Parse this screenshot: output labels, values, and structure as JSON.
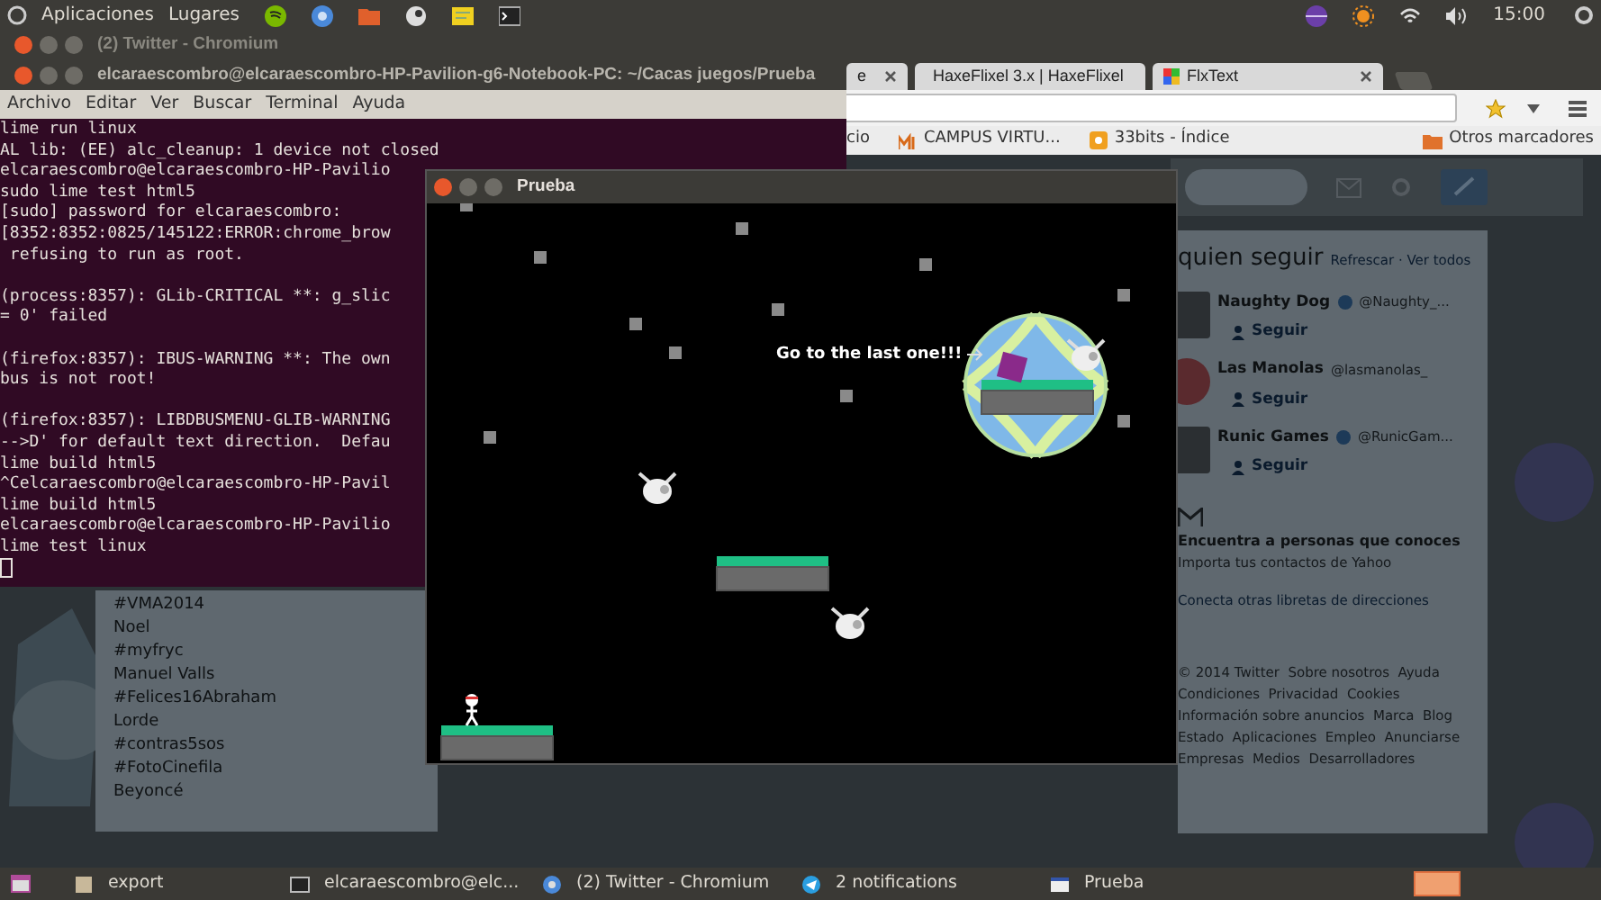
{
  "top_panel": {
    "menus": [
      "Aplicaciones",
      "Lugares"
    ],
    "clock": "15:00"
  },
  "browser": {
    "title": "(2) Twitter - Chromium",
    "tabs": [
      {
        "label": "e",
        "selected": false
      },
      {
        "label": "HaxeFlixel 3.x | HaxeFlixel",
        "selected": false
      },
      {
        "label": "FlxText",
        "selected": false
      }
    ],
    "bookmarks": [
      "cio",
      "CAMPUS VIRTU...",
      "33bits - Índice"
    ],
    "other_bookmarks": "Otros marcadores",
    "trends": [
      "#VMA2014",
      "Noel",
      "#myfryc",
      "Manuel Valls",
      "#Felices16Abraham",
      "Lorde",
      "#contras5sos",
      "#FotoCinefila",
      "Beyoncé"
    ],
    "who_to_follow": {
      "heading": "quien seguir",
      "links": "Refrescar · Ver todos",
      "accounts": [
        {
          "name": "Naughty Dog",
          "handle": "@Naughty_...",
          "button": "Seguir",
          "verified": true
        },
        {
          "name": "Las Manolas",
          "handle": "@lasmanolas_",
          "button": "Seguir",
          "verified": false
        },
        {
          "name": "Runic Games",
          "handle": "@RunicGam...",
          "button": "Seguir",
          "verified": true
        }
      ],
      "find_title": "Encuentra a personas que conoces",
      "find_sub": "Importa tus contactos de Yahoo",
      "connect": "Conecta otras libretas de direcciones"
    },
    "footer": [
      "© 2014 Twitter  Sobre nosotros  Ayuda",
      "Condiciones  Privacidad  Cookies",
      "Información sobre anuncios  Marca  Blog",
      "Estado  Aplicaciones  Empleo  Anunciarse",
      "Empresas  Medios  Desarrolladores"
    ]
  },
  "terminal": {
    "title": "elcaraescombro@elcaraescombro-HP-Pavilion-g6-Notebook-PC: ~/Cacas juegos/Prueba",
    "menu": [
      "Archivo",
      "Editar",
      "Ver",
      "Buscar",
      "Terminal",
      "Ayuda"
    ],
    "blocks": [
      [
        "lime run linux",
        "AL lib: (EE) alc_cleanup: 1 device not closed",
        "elcaraescombro@elcaraescombro-HP-Pavilio",
        "sudo lime test html5",
        "[sudo] password for elcaraescombro:",
        "[8352:8352:0825/145122:ERROR:chrome_brow",
        " refusing to run as root."
      ],
      [
        "(process:8357): GLib-CRITICAL **: g_slic",
        "= 0' failed"
      ],
      [
        "(firefox:8357): IBUS-WARNING **: The own",
        "bus is not root!"
      ],
      [
        "(firefox:8357): LIBDBUSMENU-GLIB-WARNING",
        "-->D' for default text direction.  Defau",
        "lime build html5",
        "^Celcaraescombro@elcaraescombro-HP-Pavil",
        "lime build html5",
        "elcaraescombro@elcaraescombro-HP-Pavilio",
        "lime test linux"
      ]
    ]
  },
  "game": {
    "title": "Prueba",
    "message": "Go to the last one!!!"
  },
  "taskbar": [
    {
      "kind": "box",
      "label": "export"
    },
    {
      "kind": "terminal",
      "label": "elcaraescombro@elc..."
    },
    {
      "kind": "globe",
      "label": "(2) Twitter - Chromium"
    },
    {
      "kind": "plane",
      "label": "2 notifications"
    },
    {
      "kind": "window",
      "label": "Prueba"
    }
  ]
}
